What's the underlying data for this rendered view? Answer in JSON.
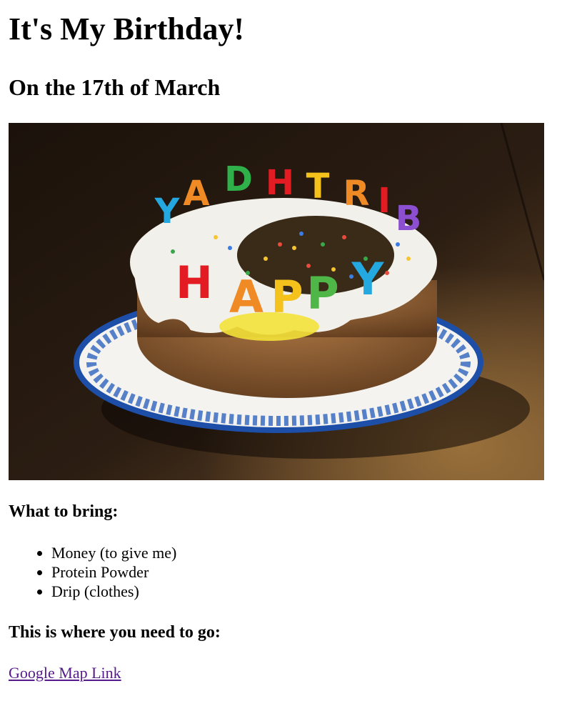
{
  "header": {
    "title": "It's My Birthday!",
    "subtitle": "On the 17th of March"
  },
  "hero_image": {
    "candle_letters_back": [
      "Y",
      "A",
      "D",
      "H",
      "T",
      "R",
      "I",
      "B"
    ],
    "candle_letters_front": [
      "H",
      "A",
      "P",
      "P",
      "Y"
    ],
    "colors": {
      "background": "#2a1d12",
      "plate_rim": "#1d4fa8",
      "frosting": "#f2f0ea",
      "cake": "#8a5a33"
    }
  },
  "bring_section": {
    "heading": "What to bring:",
    "items": [
      "Money (to give me)",
      "Protein Powder",
      "Drip (clothes)"
    ]
  },
  "location_section": {
    "heading": "This is where you need to go:",
    "link_text": "Google Map Link"
  }
}
